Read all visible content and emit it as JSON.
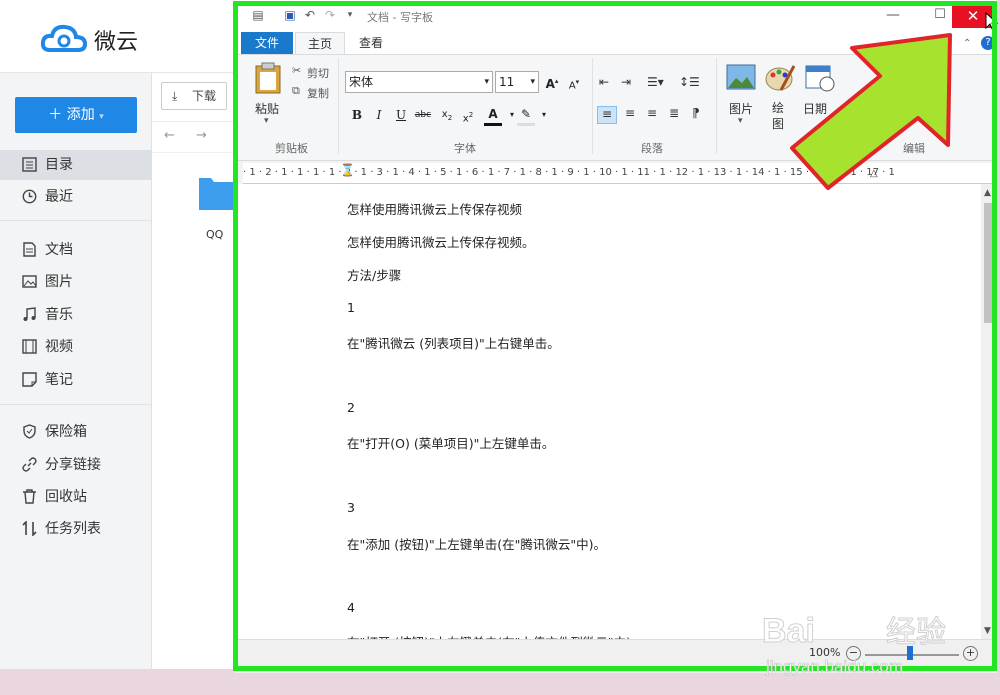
{
  "weiyun": {
    "logo_text": "微云",
    "add_button": "＋ 添加",
    "download_button": "下载",
    "folder_label": "QQ",
    "nav_items": [
      {
        "label": "目录",
        "icon": "list-icon"
      },
      {
        "label": "最近",
        "icon": "clock-icon"
      },
      {
        "label": "文档",
        "icon": "document-icon"
      },
      {
        "label": "图片",
        "icon": "image-icon"
      },
      {
        "label": "音乐",
        "icon": "music-icon"
      },
      {
        "label": "视频",
        "icon": "video-icon"
      },
      {
        "label": "笔记",
        "icon": "note-icon"
      },
      {
        "label": "保险箱",
        "icon": "shield-icon"
      },
      {
        "label": "分享链接",
        "icon": "link-icon"
      },
      {
        "label": "回收站",
        "icon": "trash-icon"
      },
      {
        "label": "任务列表",
        "icon": "task-icon"
      }
    ]
  },
  "wordpad": {
    "title": "文档 - 写字板",
    "tabs": {
      "file": "文件",
      "home": "主页",
      "view": "查看"
    },
    "clipboard": {
      "paste": "粘贴",
      "cut": "剪切",
      "copy": "复制",
      "group": "剪贴板"
    },
    "font": {
      "name": "宋体",
      "size": "11",
      "group": "字体"
    },
    "paragraph": {
      "group": "段落"
    },
    "insert": {
      "picture": "图片",
      "drawing": "绘图",
      "datetime": "日期"
    },
    "editing": {
      "group": "编辑"
    },
    "ruler": "· 1 · 2 · 1 · 1 · 1 · 1 · 2 · 1 · 3 · 1 · 4 · 1 · 5 · 1 · 6 · 1 · 7 · 1 · 8 · 1 · 9 · 1 · 10 · 1 · 11 · 1 · 12 · 1 · 13 · 1 · 14 · 1 · 15 · 1 · 16 · 1 · 17 · 1",
    "doc_lines": [
      "怎样使用腾讯微云上传保存视频",
      "怎样使用腾讯微云上传保存视频。",
      "方法/步骤",
      "1",
      "在\"腾讯微云 (列表项目)\"上右键单击。",
      "2",
      "在\"打开(O) (菜单项目)\"上左键单击。",
      "3",
      "在\"添加 (按钮)\"上左键单击(在\"腾讯微云\"中)。",
      "4",
      "在\"打开 (按钮)\"上左键单击(在\"上传文件到微云\"中)。"
    ],
    "zoom": "100%"
  },
  "watermark": {
    "text": "Bai du 经验",
    "url": "jingyan.baidu.com"
  },
  "colors": {
    "accent": "#1f87e6",
    "frame": "#22e622",
    "arrow": "#a6e22e",
    "close": "#e81123"
  }
}
